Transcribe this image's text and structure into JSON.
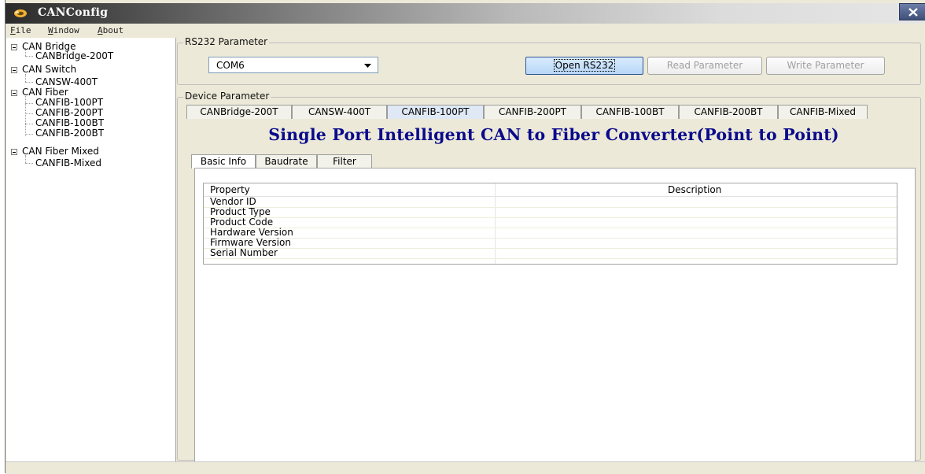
{
  "window": {
    "title": "CANConfig",
    "close_label": "X"
  },
  "menu": [
    "File",
    "Window",
    "About"
  ],
  "tree": [
    {
      "label": "CAN Bridge",
      "children": [
        "CANBridge-200T"
      ]
    },
    {
      "label": "CAN Switch",
      "children": [
        "CANSW-400T"
      ]
    },
    {
      "label": "CAN Fiber",
      "children": [
        "CANFIB-100PT",
        "CANFIB-200PT",
        "CANFIB-100BT",
        "CANFIB-200BT"
      ]
    },
    {
      "label": "CAN Fiber Mixed",
      "children": [
        "CANFIB-Mixed"
      ]
    }
  ],
  "rs232": {
    "group_title": "RS232 Parameter",
    "port_value": "COM6",
    "open_label": "Open RS232",
    "read_label": "Read Parameter",
    "write_label": "Write Parameter"
  },
  "device": {
    "group_title": "Device Parameter",
    "tabs": [
      "CANBridge-200T",
      "CANSW-400T",
      "CANFIB-100PT",
      "CANFIB-200PT",
      "CANFIB-100BT",
      "CANFIB-200BT",
      "CANFIB-Mixed"
    ],
    "active_tab": "CANFIB-100PT",
    "headline": "Single Port Intelligent CAN to Fiber Converter(Point to Point)",
    "subtabs": [
      "Basic Info",
      "Baudrate",
      "Filter"
    ],
    "active_subtab": "Basic Info"
  },
  "table": {
    "columns": [
      "Property",
      "Description"
    ],
    "rows": [
      "Vendor ID",
      "Product Type",
      "Product Code",
      "Hardware Version",
      "Firmware Version",
      "Serial Number"
    ]
  },
  "colors": {
    "headline": "#0a0a8c",
    "active_tab": "#dfe9f6",
    "primary_button": "#b7d6f5"
  }
}
